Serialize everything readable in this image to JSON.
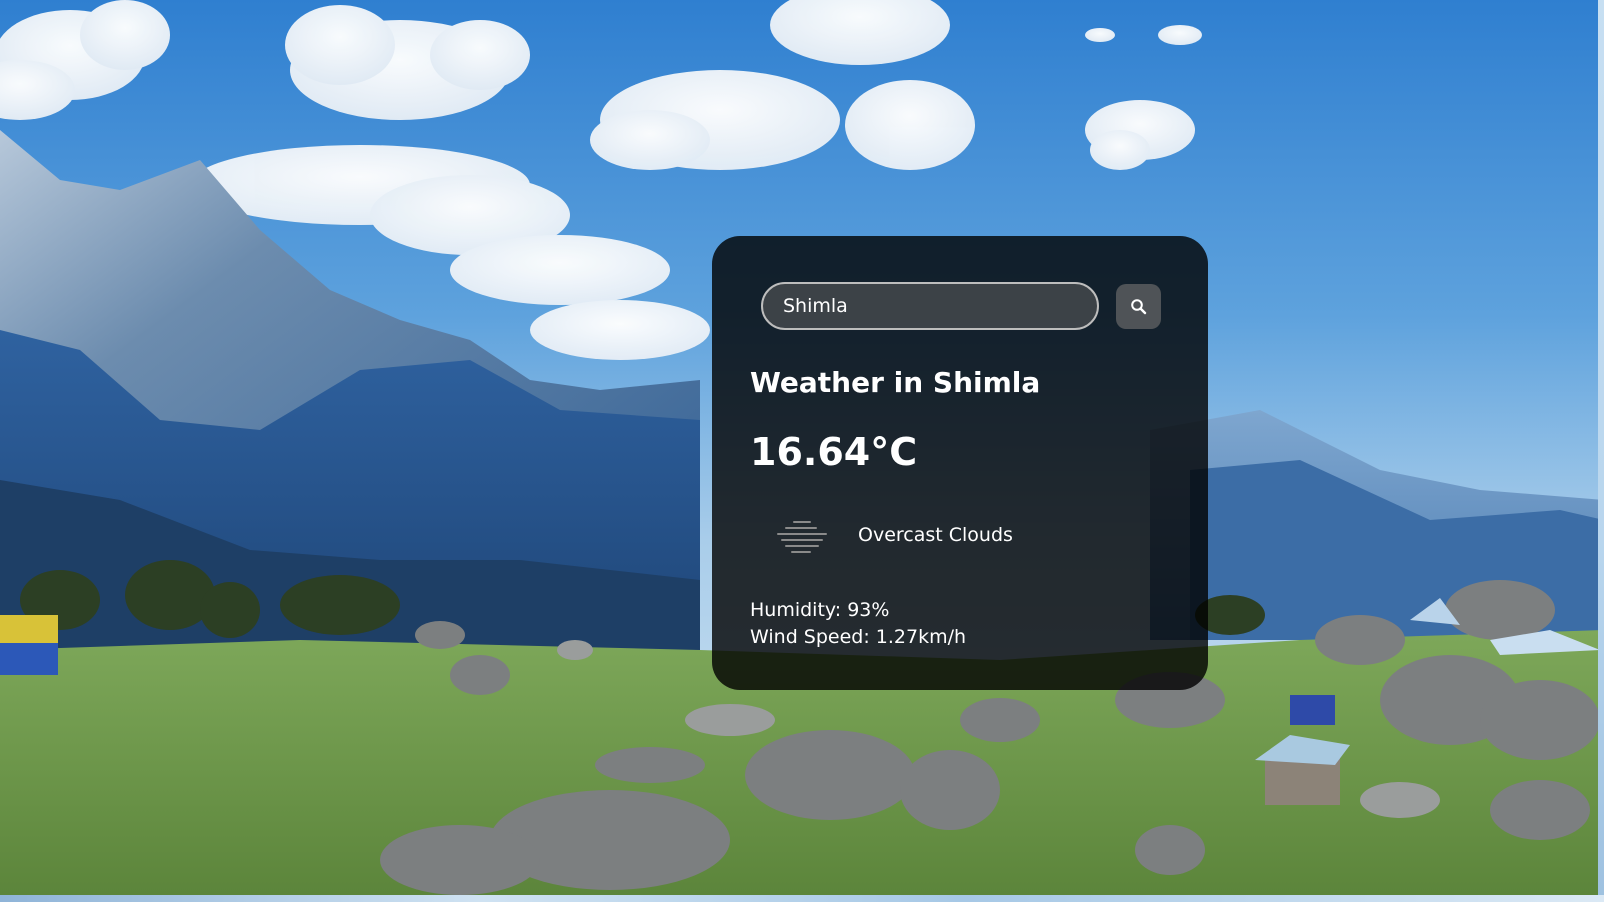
{
  "search": {
    "value": "Shimla",
    "button_icon": "search-icon"
  },
  "weather": {
    "title": "Weather in Shimla",
    "temperature": "16.64°C",
    "condition_icon": "overcast-clouds-icon",
    "description": "Overcast Clouds",
    "humidity": "Humidity: 93%",
    "wind": "Wind Speed: 1.27km/h"
  },
  "colors": {
    "card_background": "#000000",
    "text": "#ffffff",
    "input_border": "#bdbdbd",
    "sky": "#3f8fd6",
    "mountains": "#2f5f9a",
    "meadow": "#6c9a45"
  }
}
